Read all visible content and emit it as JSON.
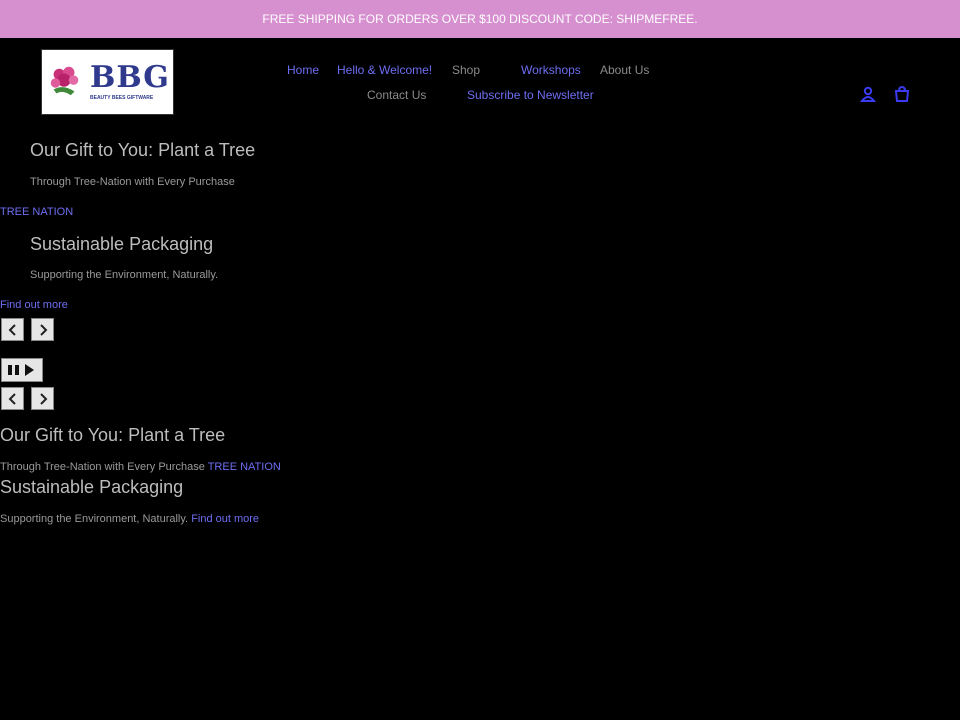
{
  "announcement": {
    "text": "FREE SHIPPING FOR ORDERS OVER $100 DISCOUNT CODE: SHIPMEFREE."
  },
  "logo": {
    "text": "BBG",
    "tagline": "BEAUTY BEES GIFTWARE"
  },
  "nav": {
    "items": [
      {
        "label": "Home"
      },
      {
        "label": "Hello & Welcome!"
      },
      {
        "label": "Shop"
      },
      {
        "label": "Workshops"
      },
      {
        "label": "About Us"
      },
      {
        "label": "Contact Us"
      },
      {
        "label": "Subscribe to Newsletter"
      }
    ]
  },
  "header_icons": {
    "account": "person-icon",
    "cart": "bag-icon"
  },
  "slides": [
    {
      "title": "Our Gift to You: Plant a Tree",
      "subtitle": "Through Tree-Nation with Every Purchase",
      "link": "TREE NATION"
    },
    {
      "title": "Sustainable Packaging",
      "subtitle": "Supporting the Environment, Naturally.",
      "link": "Find out more"
    }
  ],
  "controls": {
    "prev_icon": "chevron-left-icon",
    "next_icon": "chevron-right-icon",
    "pause_icon": "pause-play-icon"
  },
  "colors": {
    "announcement_bg": "#d68fcf",
    "link": "#6e6ef2",
    "background": "#000000",
    "logo_blue": "#2f3a8c"
  }
}
